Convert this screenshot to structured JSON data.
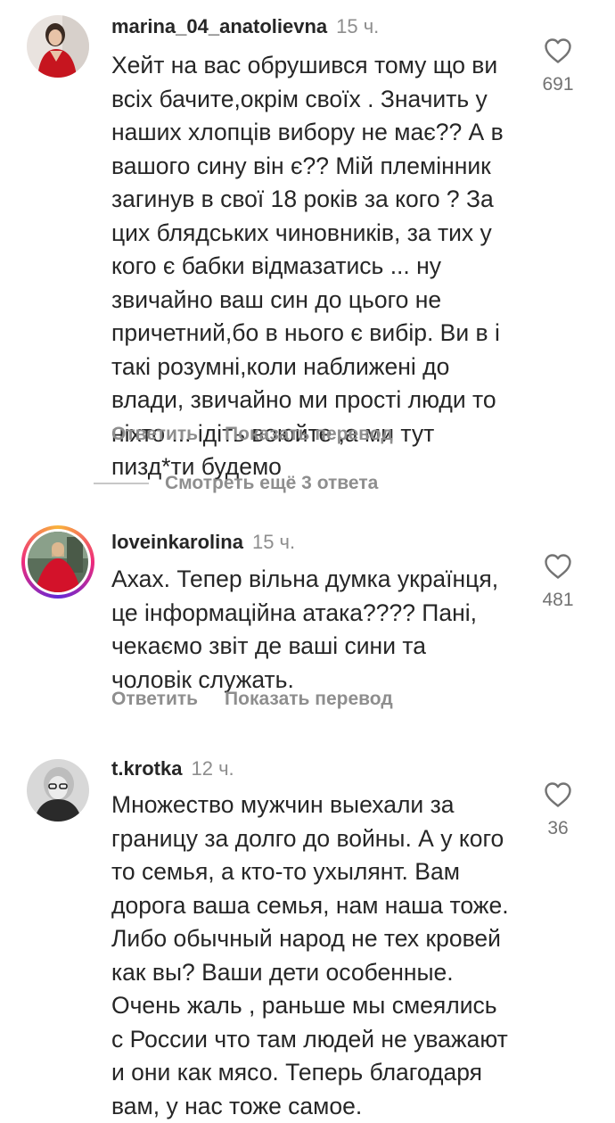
{
  "comments": [
    {
      "username": "marina_04_anatolievna",
      "time": "15 ч.",
      "lines": [
        "Хейт на вас обрушився тому що ви",
        "всіх бачите,окрім своїх . Значить у",
        "наших хлопців вибору не має?? А в",
        "вашого сину він є?? Мій племінник",
        "загинув в свої 18 років за кого ? За",
        "цих блядських чиновників, за тих у",
        "кого є бабки відмазатись ... ну",
        "звичайно ваш син до цього не",
        "причетний,бо в нього є вибір. Ви в і",
        "такі розумні,коли наближені до",
        "влади, звичайно ми прості люди то",
        "ніхто ... ідіть воюйте ,а ми тут",
        "пизд*ти будемо"
      ],
      "likes": "691",
      "reply_label": "Ответить",
      "translate_label": "Показать перевод"
    },
    {
      "username": "loveinkarolina",
      "time": "15 ч.",
      "lines": [
        "Ахах. Тепер вільна думка українця,",
        "це інформаційна атака???? Пані,",
        "чекаємо звіт де ваші сини та",
        "чоловік служать."
      ],
      "likes": "481",
      "reply_label": "Ответить",
      "translate_label": "Показать перевод"
    },
    {
      "username": "t.krotka",
      "time": "12 ч.",
      "lines": [
        "Множество мужчин выехали за",
        "границу за долго до войны. А у кого",
        "то семья, а кто-то ухылянт. Вам",
        "дорога ваша семья, нам наша тоже.",
        "Либо обычный народ не тех кровей",
        "как вы? Ваши дети особенные.",
        "Очень жаль , раньше мы смеялись",
        "с России что там людей не уважают",
        "и они как мясо. Теперь благодаря",
        "вам, у нас тоже самое."
      ],
      "likes": "36"
    }
  ],
  "view_more_replies": "Смотреть ещё 3 ответа",
  "icons": {
    "like": "heart-outline-icon"
  },
  "colors": {
    "text": "#262626",
    "secondary": "#8e8e8e",
    "story_ring": "#ee2a7b"
  }
}
